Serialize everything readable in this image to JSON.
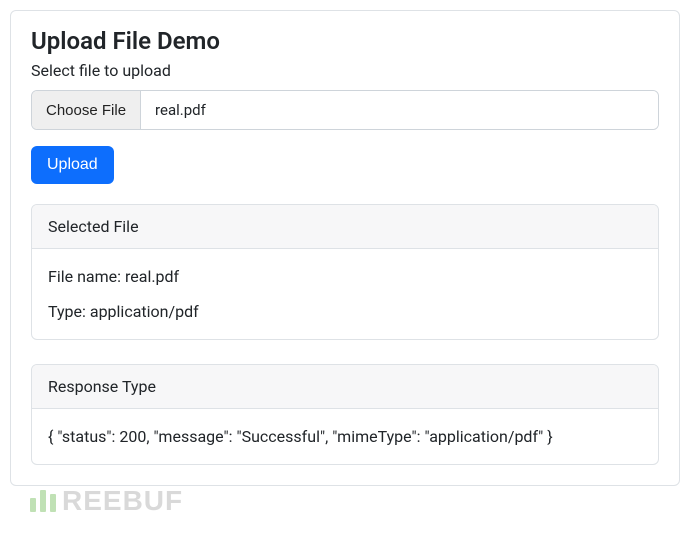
{
  "page": {
    "title": "Upload File Demo",
    "subtitle": "Select file to upload"
  },
  "file_input": {
    "choose_label": "Choose File",
    "selected_name": "real.pdf"
  },
  "upload_button": {
    "label": "Upload"
  },
  "selected_file_card": {
    "header": "Selected File",
    "filename_line": "File name: real.pdf",
    "type_line": "Type: application/pdf"
  },
  "response_card": {
    "header": "Response Type",
    "body": "{ \"status\": 200, \"message\": \"Successful\", \"mimeType\": \"application/pdf\" }"
  },
  "watermark": {
    "text": "REEBUF"
  }
}
